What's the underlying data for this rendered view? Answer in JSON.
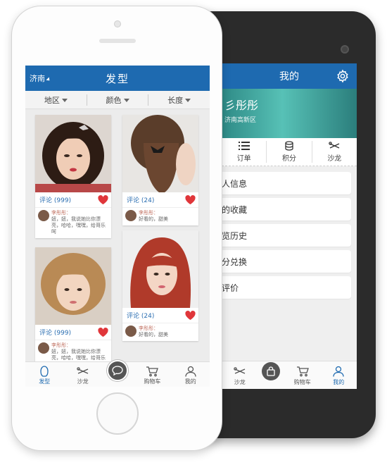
{
  "android": {
    "title": "我的",
    "profile": {
      "name": "彡彤彤",
      "location": "济南高新区"
    },
    "tabs": [
      {
        "label": "订单",
        "icon": "list-icon"
      },
      {
        "label": "积分",
        "icon": "coins-icon"
      },
      {
        "label": "沙龙",
        "icon": "scissors-icon"
      }
    ],
    "menu": [
      "人信息",
      "的收藏",
      "览历史",
      "分兑换",
      "评价"
    ],
    "bottom_nav": [
      {
        "label": "沙龙",
        "icon": "scissors-icon"
      },
      {
        "label": "",
        "icon": "bag-icon"
      },
      {
        "label": "购物车",
        "icon": "cart-icon"
      },
      {
        "label": "我的",
        "icon": "person-icon"
      }
    ]
  },
  "iphone": {
    "city": "济南",
    "title": "发型",
    "filters": [
      "地区",
      "颜色",
      "长度"
    ],
    "cards": [
      {
        "comments": "评论 (999)",
        "user": "李彤彤：",
        "text": "妞，妞，我说她比你漂亮，哈哈，嘿嘿，给哥乐呵"
      },
      {
        "comments": "评论 (24)",
        "user": "李彤彤：",
        "text": "好看的，甜美"
      },
      {
        "comments": "评论 (999)",
        "user": "李彤彤：",
        "text": "妞，妞，我说她比你漂亮，哈哈，嘿嘿，给哥乐呵"
      },
      {
        "comments": "评论 (24)",
        "user": "李彤彤：",
        "text": "好看的，甜美"
      }
    ],
    "bottom_nav": [
      {
        "label": "发型",
        "icon": "hair-icon"
      },
      {
        "label": "沙龙",
        "icon": "scissors-icon"
      },
      {
        "label": "",
        "icon": "chat-icon"
      },
      {
        "label": "购物车",
        "icon": "cart-icon"
      },
      {
        "label": "我的",
        "icon": "person-icon"
      }
    ]
  },
  "colors": {
    "header_blue": "#1e6ab0",
    "heart_red": "#e0363a",
    "teal_banner": "#3aa39c"
  }
}
